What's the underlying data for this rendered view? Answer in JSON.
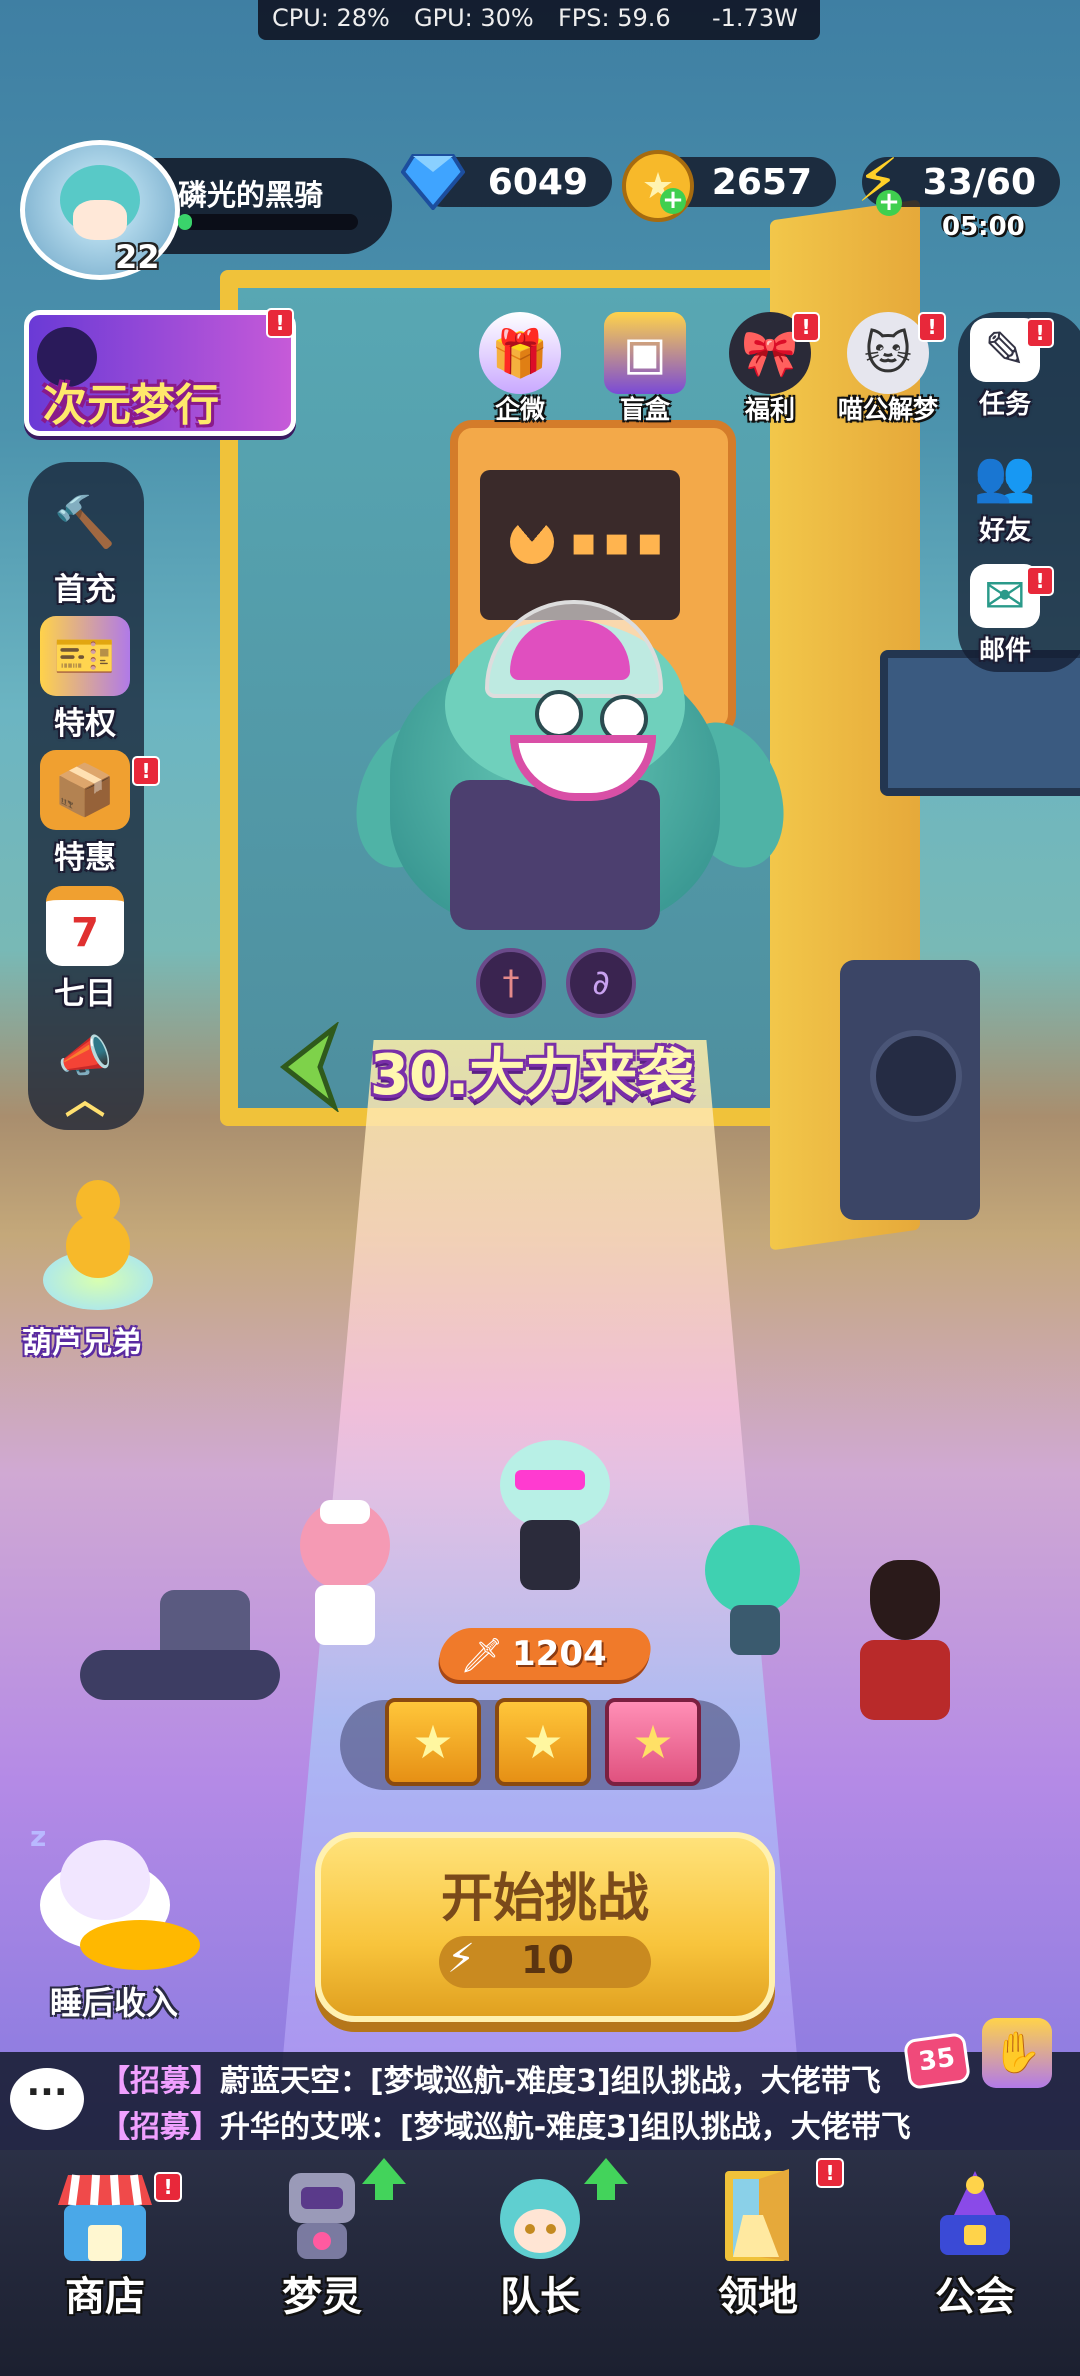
{
  "status_bar": {
    "cpu": "CPU: 28%",
    "gpu": "GPU: 30%",
    "fps": "FPS: 59.6",
    "power": "-1.73W"
  },
  "player": {
    "name": "磷光的黑骑",
    "level": "22",
    "exp_progress": 0.08
  },
  "resources": {
    "diamonds": "6049",
    "coins": "2657",
    "energy": "33/60",
    "energy_timer": "05:00"
  },
  "event_banner": {
    "label": "次元梦行",
    "badge": "!"
  },
  "top_icons": [
    {
      "label": "企微",
      "icon": "gift-icon",
      "badge": false
    },
    {
      "label": "盲盒",
      "icon": "blind-box-icon",
      "badge": false
    },
    {
      "label": "福利",
      "icon": "welfare-icon",
      "badge": true
    },
    {
      "label": "喵公解梦",
      "icon": "cat-icon",
      "badge": true
    }
  ],
  "right_menu": [
    {
      "label": "任务",
      "icon": "task-icon",
      "badge": true
    },
    {
      "label": "好友",
      "icon": "friends-icon",
      "badge": false
    },
    {
      "label": "邮件",
      "icon": "mail-icon",
      "badge": true
    }
  ],
  "left_menu": [
    {
      "label": "首充",
      "icon": "hammer-icon",
      "badge": false
    },
    {
      "label": "特权",
      "icon": "privilege-card-icon",
      "badge": false
    },
    {
      "label": "特惠",
      "icon": "discount-box-icon",
      "badge": true
    },
    {
      "label": "七日",
      "icon": "calendar-icon",
      "calendar_number": "7",
      "badge": false
    }
  ],
  "gourd": {
    "label": "葫芦兄弟"
  },
  "stage": {
    "title": "30.大力来袭"
  },
  "team": {
    "power": "1204"
  },
  "challenge": {
    "label": "开始挑战",
    "cost": "10"
  },
  "idle_reward": {
    "label": "睡后收入"
  },
  "chat": {
    "unread": "35",
    "messages": [
      {
        "tag": "【招募】",
        "text": "蔚蓝天空：[梦域巡航-难度3]组队挑战，大佬带飞"
      },
      {
        "tag": "【招募】",
        "text": "升华的艾咪：[梦域巡航-难度3]组队挑战，大佬带飞"
      }
    ]
  },
  "bottom_nav": [
    {
      "label": "商店",
      "icon": "shop-icon",
      "badge": true,
      "upgrade": false
    },
    {
      "label": "梦灵",
      "icon": "robot-icon",
      "badge": false,
      "upgrade": true
    },
    {
      "label": "队长",
      "icon": "captain-icon",
      "badge": false,
      "upgrade": true
    },
    {
      "label": "领地",
      "icon": "territory-door-icon",
      "badge": true,
      "upgrade": false
    },
    {
      "label": "公会",
      "icon": "guild-icon",
      "badge": false,
      "upgrade": false
    }
  ]
}
